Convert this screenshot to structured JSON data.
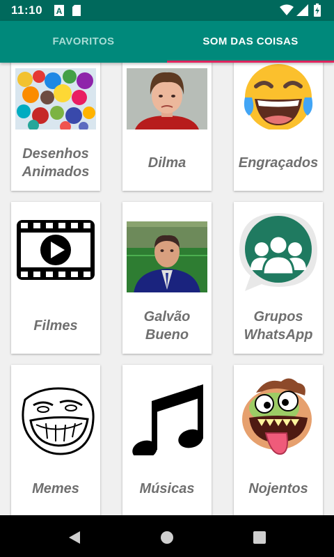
{
  "status_bar": {
    "time": "11:10"
  },
  "tabs": [
    {
      "label": "FAVORITOS",
      "active": false
    },
    {
      "label": "SOM DAS COISAS",
      "active": true
    }
  ],
  "categories": [
    {
      "label": "Desenhos Animados",
      "icon": "cartoon-collage-image"
    },
    {
      "label": "Dilma",
      "icon": "dilma-photo"
    },
    {
      "label": "Engraçados",
      "icon": "laughing-emoji-icon"
    },
    {
      "label": "Filmes",
      "icon": "film-strip-icon"
    },
    {
      "label": "Galvão Bueno",
      "icon": "galvao-bueno-photo"
    },
    {
      "label": "Grupos WhatsApp",
      "icon": "whatsapp-group-icon"
    },
    {
      "label": "Memes",
      "icon": "trollface-icon"
    },
    {
      "label": "Músicas",
      "icon": "music-note-icon"
    },
    {
      "label": "Nojentos",
      "icon": "gross-face-icon"
    }
  ],
  "colors": {
    "primary": "#00897b",
    "primary_dark": "#00695c",
    "accent": "#e0245e"
  }
}
